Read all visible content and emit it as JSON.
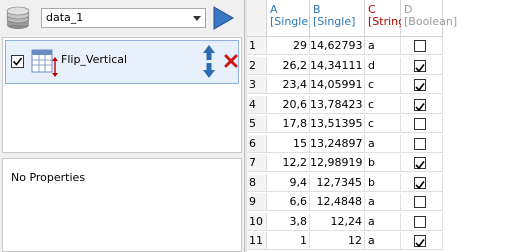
{
  "toolbar": {
    "dataset": "data_1"
  },
  "filters": [
    {
      "label": "Flip_Vertical",
      "enabled": true
    }
  ],
  "properties": {
    "text": "No Properties"
  },
  "grid": {
    "columns": [
      {
        "letter": "A",
        "type": "[Single]",
        "color": "#2e75b6"
      },
      {
        "letter": "B",
        "type": "[Single]",
        "color": "#2e75b6"
      },
      {
        "letter": "C",
        "type": "[String]",
        "color": "#c00000"
      },
      {
        "letter": "D",
        "type": "[Boolean]",
        "color": "#9a9a9a"
      }
    ],
    "rows": [
      {
        "n": "1",
        "a": "29",
        "b": "14,62793",
        "c": "a",
        "d": false
      },
      {
        "n": "2",
        "a": "26,2",
        "b": "14,34111",
        "c": "d",
        "d": true
      },
      {
        "n": "3",
        "a": "23,4",
        "b": "14,05991",
        "c": "c",
        "d": true
      },
      {
        "n": "4",
        "a": "20,6",
        "b": "13,78423",
        "c": "c",
        "d": true
      },
      {
        "n": "5",
        "a": "17,8",
        "b": "13,51395",
        "c": "c",
        "d": false
      },
      {
        "n": "6",
        "a": "15",
        "b": "13,24897",
        "c": "a",
        "d": false
      },
      {
        "n": "7",
        "a": "12,2",
        "b": "12,98919",
        "c": "b",
        "d": true
      },
      {
        "n": "8",
        "a": "9,4",
        "b": "12,7345",
        "c": "b",
        "d": true
      },
      {
        "n": "9",
        "a": "6,6",
        "b": "12,4848",
        "c": "a",
        "d": false
      },
      {
        "n": "10",
        "a": "3,8",
        "b": "12,24",
        "c": "a",
        "d": false
      },
      {
        "n": "11",
        "a": "1",
        "b": "12",
        "c": "a",
        "d": true
      }
    ]
  },
  "icons": {
    "database": "database-icon",
    "run": "play-icon",
    "filter": "flip-vertical-icon",
    "up": "arrow-up-icon",
    "down": "arrow-down-icon",
    "remove": "close-icon"
  }
}
